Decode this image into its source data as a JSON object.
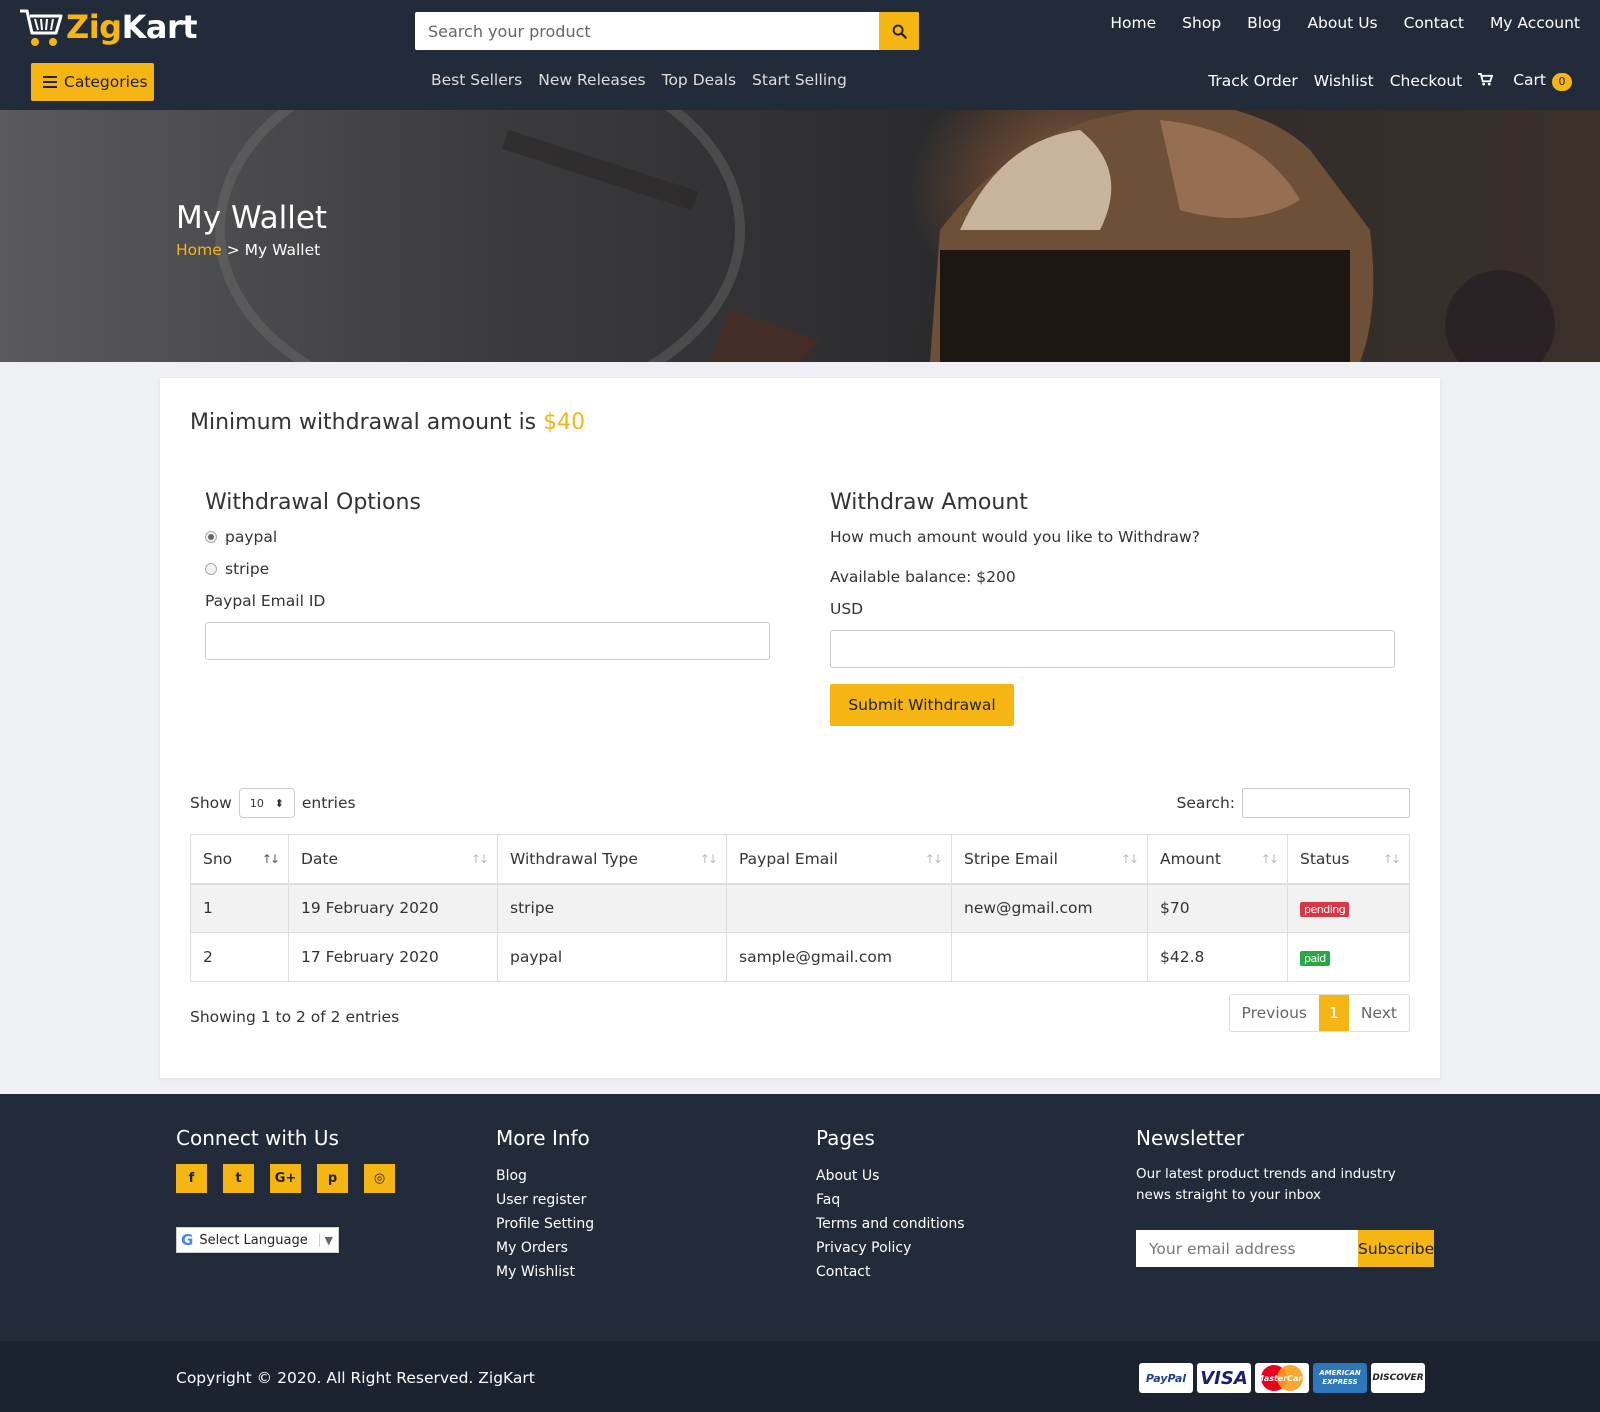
{
  "header": {
    "brand_pre": "Zig",
    "brand_post": "Kart",
    "search_placeholder": "Search your product",
    "top_nav": [
      "Home",
      "Shop",
      "Blog",
      "About Us",
      "Contact",
      "My Account"
    ],
    "categories_label": "Categories",
    "mid_nav": [
      "Best Sellers",
      "New Releases",
      "Top Deals",
      "Start Selling"
    ],
    "right_nav": [
      "Track Order",
      "Wishlist",
      "Checkout"
    ],
    "cart_label": "Cart",
    "cart_count": "0"
  },
  "hero": {
    "title": "My Wallet",
    "breadcrumb_home": "Home",
    "breadcrumb_sep": ">",
    "breadcrumb_current": "My Wallet"
  },
  "wallet": {
    "min_withdrawal_text": "Minimum withdrawal amount is",
    "min_withdrawal_amount": "$40",
    "options_title": "Withdrawal Options",
    "option_paypal": "paypal",
    "option_stripe": "stripe",
    "paypal_email_label": "Paypal Email ID",
    "amount_title": "Withdraw Amount",
    "amount_question": "How much amount would you like to Withdraw?",
    "available_balance": "Available balance: $200",
    "currency_label": "USD",
    "submit_label": "Submit Withdrawal"
  },
  "table": {
    "show_label": "Show",
    "page_size": "10",
    "entries_label": "entries",
    "search_label": "Search:",
    "columns": [
      "Sno",
      "Date",
      "Withdrawal Type",
      "Paypal Email",
      "Stripe Email",
      "Amount",
      "Status"
    ],
    "rows": [
      {
        "sno": "1",
        "date": "19 February 2020",
        "type": "stripe",
        "paypal": "",
        "stripe": "new@gmail.com",
        "amount": "$70",
        "status": "pending"
      },
      {
        "sno": "2",
        "date": "17 February 2020",
        "type": "paypal",
        "paypal": "sample@gmail.com",
        "stripe": "",
        "amount": "$42.8",
        "status": "paid"
      }
    ],
    "summary": "Showing 1 to 2 of 2 entries",
    "prev_label": "Previous",
    "current_page": "1",
    "next_label": "Next"
  },
  "footer": {
    "connect_title": "Connect with Us",
    "social_icons": [
      "facebook-icon",
      "twitter-icon",
      "google-plus-icon",
      "pinterest-icon",
      "instagram-icon"
    ],
    "social_glyphs": [
      "f",
      "t",
      "G+",
      "p",
      "◎"
    ],
    "language_label": "Select Language",
    "more_info_title": "More Info",
    "more_info_links": [
      "Blog",
      "User register",
      "Profile Setting",
      "My Orders",
      "My Wishlist"
    ],
    "pages_title": "Pages",
    "pages_links": [
      "About Us",
      "Faq",
      "Terms and conditions",
      "Privacy Policy",
      "Contact"
    ],
    "newsletter_title": "Newsletter",
    "newsletter_text": "Our latest product trends and industry news straight to your inbox",
    "newsletter_placeholder": "Your email address",
    "subscribe_label": "Subscribe",
    "copyright": "Copyright © 2020. All Right Reserved. ZigKart",
    "payment_cards": [
      "PayPal",
      "VISA",
      "MasterCard",
      "AMERICAN EXPRESS",
      "DISCOVER"
    ]
  },
  "colors": {
    "accent": "#f5b614",
    "header_bg": "#222b3a",
    "pending": "#dc3545",
    "paid": "#28a745"
  }
}
